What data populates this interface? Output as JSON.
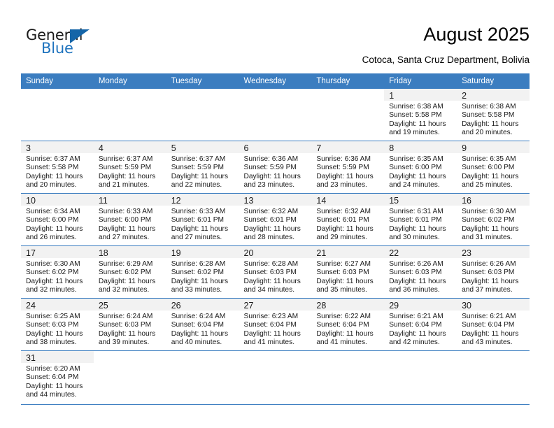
{
  "brand": {
    "name_part1": "General",
    "name_part2": "Blue",
    "triangle_color": "#1565a8",
    "blue_text_color": "#1e73be"
  },
  "header": {
    "title": "August 2025",
    "subtitle": "Cotoca, Santa Cruz Department, Bolivia"
  },
  "theme": {
    "header_blue": "#3b7dc0",
    "daynum_strip_gray": "#f2f2f2",
    "grid_line": "#3b7dc0"
  },
  "weekdays": [
    "Sunday",
    "Monday",
    "Tuesday",
    "Wednesday",
    "Thursday",
    "Friday",
    "Saturday"
  ],
  "weeks": [
    [
      {
        "day": "",
        "lines": [],
        "state": "blank"
      },
      {
        "day": "",
        "lines": [],
        "state": "blank"
      },
      {
        "day": "",
        "lines": [],
        "state": "blank"
      },
      {
        "day": "",
        "lines": [],
        "state": "blank"
      },
      {
        "day": "",
        "lines": [],
        "state": "blank"
      },
      {
        "day": "1",
        "state": "filled",
        "lines": [
          "Sunrise: 6:38 AM",
          "Sunset: 5:58 PM",
          "Daylight: 11 hours",
          "and 19 minutes."
        ]
      },
      {
        "day": "2",
        "state": "filled",
        "lines": [
          "Sunrise: 6:38 AM",
          "Sunset: 5:58 PM",
          "Daylight: 11 hours",
          "and 20 minutes."
        ]
      }
    ],
    [
      {
        "day": "3",
        "state": "filled",
        "lines": [
          "Sunrise: 6:37 AM",
          "Sunset: 5:58 PM",
          "Daylight: 11 hours",
          "and 20 minutes."
        ]
      },
      {
        "day": "4",
        "state": "filled",
        "lines": [
          "Sunrise: 6:37 AM",
          "Sunset: 5:59 PM",
          "Daylight: 11 hours",
          "and 21 minutes."
        ]
      },
      {
        "day": "5",
        "state": "filled",
        "lines": [
          "Sunrise: 6:37 AM",
          "Sunset: 5:59 PM",
          "Daylight: 11 hours",
          "and 22 minutes."
        ]
      },
      {
        "day": "6",
        "state": "filled",
        "lines": [
          "Sunrise: 6:36 AM",
          "Sunset: 5:59 PM",
          "Daylight: 11 hours",
          "and 23 minutes."
        ]
      },
      {
        "day": "7",
        "state": "filled",
        "lines": [
          "Sunrise: 6:36 AM",
          "Sunset: 5:59 PM",
          "Daylight: 11 hours",
          "and 23 minutes."
        ]
      },
      {
        "day": "8",
        "state": "filled",
        "lines": [
          "Sunrise: 6:35 AM",
          "Sunset: 6:00 PM",
          "Daylight: 11 hours",
          "and 24 minutes."
        ]
      },
      {
        "day": "9",
        "state": "filled",
        "lines": [
          "Sunrise: 6:35 AM",
          "Sunset: 6:00 PM",
          "Daylight: 11 hours",
          "and 25 minutes."
        ]
      }
    ],
    [
      {
        "day": "10",
        "state": "filled",
        "lines": [
          "Sunrise: 6:34 AM",
          "Sunset: 6:00 PM",
          "Daylight: 11 hours",
          "and 26 minutes."
        ]
      },
      {
        "day": "11",
        "state": "filled",
        "lines": [
          "Sunrise: 6:33 AM",
          "Sunset: 6:00 PM",
          "Daylight: 11 hours",
          "and 27 minutes."
        ]
      },
      {
        "day": "12",
        "state": "filled",
        "lines": [
          "Sunrise: 6:33 AM",
          "Sunset: 6:01 PM",
          "Daylight: 11 hours",
          "and 27 minutes."
        ]
      },
      {
        "day": "13",
        "state": "filled",
        "lines": [
          "Sunrise: 6:32 AM",
          "Sunset: 6:01 PM",
          "Daylight: 11 hours",
          "and 28 minutes."
        ]
      },
      {
        "day": "14",
        "state": "filled",
        "lines": [
          "Sunrise: 6:32 AM",
          "Sunset: 6:01 PM",
          "Daylight: 11 hours",
          "and 29 minutes."
        ]
      },
      {
        "day": "15",
        "state": "filled",
        "lines": [
          "Sunrise: 6:31 AM",
          "Sunset: 6:01 PM",
          "Daylight: 11 hours",
          "and 30 minutes."
        ]
      },
      {
        "day": "16",
        "state": "filled",
        "lines": [
          "Sunrise: 6:30 AM",
          "Sunset: 6:02 PM",
          "Daylight: 11 hours",
          "and 31 minutes."
        ]
      }
    ],
    [
      {
        "day": "17",
        "state": "filled",
        "lines": [
          "Sunrise: 6:30 AM",
          "Sunset: 6:02 PM",
          "Daylight: 11 hours",
          "and 32 minutes."
        ]
      },
      {
        "day": "18",
        "state": "filled",
        "lines": [
          "Sunrise: 6:29 AM",
          "Sunset: 6:02 PM",
          "Daylight: 11 hours",
          "and 32 minutes."
        ]
      },
      {
        "day": "19",
        "state": "filled",
        "lines": [
          "Sunrise: 6:28 AM",
          "Sunset: 6:02 PM",
          "Daylight: 11 hours",
          "and 33 minutes."
        ]
      },
      {
        "day": "20",
        "state": "filled",
        "lines": [
          "Sunrise: 6:28 AM",
          "Sunset: 6:03 PM",
          "Daylight: 11 hours",
          "and 34 minutes."
        ]
      },
      {
        "day": "21",
        "state": "filled",
        "lines": [
          "Sunrise: 6:27 AM",
          "Sunset: 6:03 PM",
          "Daylight: 11 hours",
          "and 35 minutes."
        ]
      },
      {
        "day": "22",
        "state": "filled",
        "lines": [
          "Sunrise: 6:26 AM",
          "Sunset: 6:03 PM",
          "Daylight: 11 hours",
          "and 36 minutes."
        ]
      },
      {
        "day": "23",
        "state": "filled",
        "lines": [
          "Sunrise: 6:26 AM",
          "Sunset: 6:03 PM",
          "Daylight: 11 hours",
          "and 37 minutes."
        ]
      }
    ],
    [
      {
        "day": "24",
        "state": "filled",
        "lines": [
          "Sunrise: 6:25 AM",
          "Sunset: 6:03 PM",
          "Daylight: 11 hours",
          "and 38 minutes."
        ]
      },
      {
        "day": "25",
        "state": "filled",
        "lines": [
          "Sunrise: 6:24 AM",
          "Sunset: 6:03 PM",
          "Daylight: 11 hours",
          "and 39 minutes."
        ]
      },
      {
        "day": "26",
        "state": "filled",
        "lines": [
          "Sunrise: 6:24 AM",
          "Sunset: 6:04 PM",
          "Daylight: 11 hours",
          "and 40 minutes."
        ]
      },
      {
        "day": "27",
        "state": "filled",
        "lines": [
          "Sunrise: 6:23 AM",
          "Sunset: 6:04 PM",
          "Daylight: 11 hours",
          "and 41 minutes."
        ]
      },
      {
        "day": "28",
        "state": "filled",
        "lines": [
          "Sunrise: 6:22 AM",
          "Sunset: 6:04 PM",
          "Daylight: 11 hours",
          "and 41 minutes."
        ]
      },
      {
        "day": "29",
        "state": "filled",
        "lines": [
          "Sunrise: 6:21 AM",
          "Sunset: 6:04 PM",
          "Daylight: 11 hours",
          "and 42 minutes."
        ]
      },
      {
        "day": "30",
        "state": "filled",
        "lines": [
          "Sunrise: 6:21 AM",
          "Sunset: 6:04 PM",
          "Daylight: 11 hours",
          "and 43 minutes."
        ]
      }
    ],
    [
      {
        "day": "31",
        "state": "filled",
        "lines": [
          "Sunrise: 6:20 AM",
          "Sunset: 6:04 PM",
          "Daylight: 11 hours",
          "and 44 minutes."
        ]
      },
      {
        "day": "",
        "lines": [],
        "state": "blank"
      },
      {
        "day": "",
        "lines": [],
        "state": "blank"
      },
      {
        "day": "",
        "lines": [],
        "state": "blank"
      },
      {
        "day": "",
        "lines": [],
        "state": "blank"
      },
      {
        "day": "",
        "lines": [],
        "state": "blank"
      },
      {
        "day": "",
        "lines": [],
        "state": "blank"
      }
    ]
  ]
}
